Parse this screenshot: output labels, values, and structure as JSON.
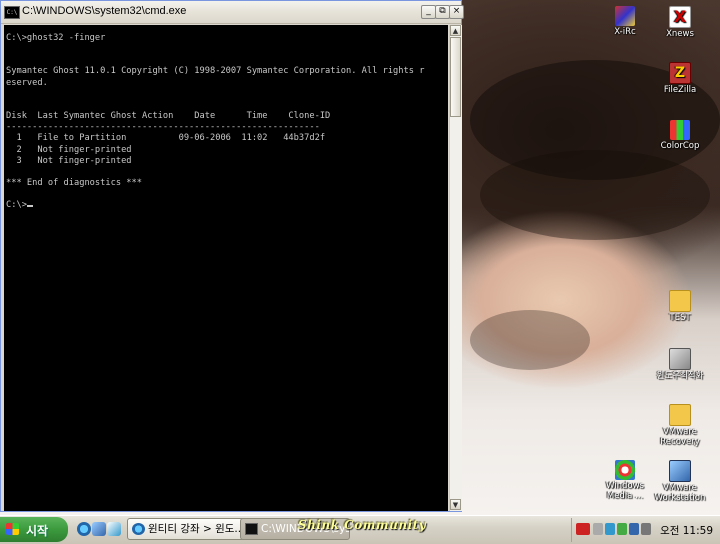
{
  "window": {
    "title": "C:\\WINDOWS\\system32\\cmd.exe",
    "icon": "cmd-icon",
    "buttons": {
      "minimize": "_",
      "restore": "⧉",
      "close": "×"
    }
  },
  "console": {
    "lines": [
      "C:\\>ghost32 -finger",
      "",
      "",
      "Symantec Ghost 11.0.1 Copyright (C) 1998-2007 Symantec Corporation. All rights r",
      "eserved.",
      "",
      "",
      "Disk  Last Symantec Ghost Action    Date      Time    Clone-ID",
      "------------------------------------------------------------",
      "  1   File to Partition          09-06-2006  11:02   44b37d2f",
      "  2   Not finger-printed",
      "  3   Not finger-printed",
      "",
      "*** End of diagnostics ***",
      "",
      "C:\\>"
    ]
  },
  "desktop_icons": [
    {
      "label": "X-iRc",
      "icon": "xirc-icon"
    },
    {
      "label": "Xnews",
      "icon": "xnews-icon"
    },
    {
      "label": "FileZilla",
      "icon": "filezilla-icon"
    },
    {
      "label": "ColorCop",
      "icon": "colorcop-icon"
    },
    {
      "label": "TEST",
      "icon": "folder-icon"
    },
    {
      "label": "윈도우최적화",
      "icon": "tool-icon"
    },
    {
      "label": "VMware Recovery",
      "icon": "folder-icon"
    },
    {
      "label": "Windows Media ...",
      "icon": "windows-media-icon"
    },
    {
      "label": "VMware Workstation",
      "icon": "vmware-icon"
    }
  ],
  "taskbar": {
    "start_label": "시작",
    "tasks": [
      {
        "label": "윈티티 강좌 > 윈도...",
        "icon": "ie-icon"
      },
      {
        "label": "C:\\WINDOWS\\system32\\cmd.exe",
        "icon": "cmd-icon"
      }
    ],
    "watermark": "Shink Community",
    "clock": "오전 11:59"
  },
  "colors": {
    "console_bg": "#000000",
    "console_fg": "#c8c8c8",
    "start_green": "#3c9a3d"
  }
}
